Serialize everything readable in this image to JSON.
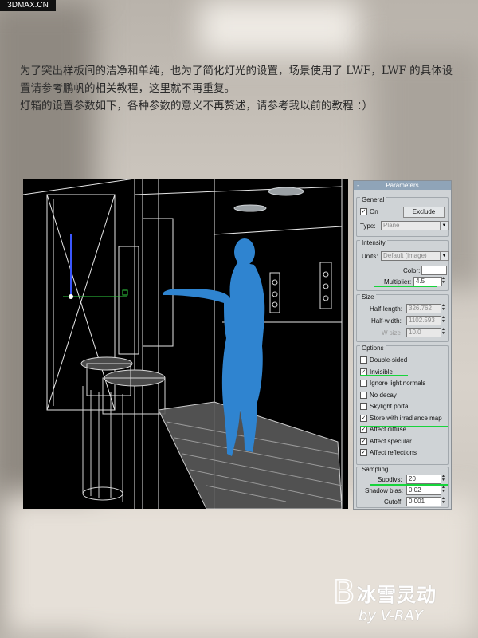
{
  "watermark_top": "3DMAX.CN",
  "intro": {
    "line1": "为了突出样板间的洁净和单纯，也为了简化灯光的设置，场景使用了 LWF，LWF 的具体设",
    "line2": "置请参考鹏帆的相关教程，这里就不再重复。",
    "line3": "灯箱的设置参数如下，各种参数的意义不再赘述，请参考我以前的教程 ：）"
  },
  "panel": {
    "title": "Parameters",
    "general": {
      "label": "General",
      "on_label": "On",
      "on_checked": true,
      "exclude_label": "Exclude",
      "type_label": "Type:",
      "type_value": "Plane"
    },
    "intensity": {
      "label": "Intensity",
      "units_label": "Units:",
      "units_value": "Default (image)",
      "color_label": "Color:",
      "color_value": "#ffffff",
      "multiplier_label": "Multiplier:",
      "multiplier_value": "4.5"
    },
    "size": {
      "label": "Size",
      "half_length_label": "Half-length:",
      "half_length_value": "326.762",
      "half_width_label": "Half-width:",
      "half_width_value": "1102.593",
      "w_size_label": "W size",
      "w_size_value": "10.0"
    },
    "options": {
      "label": "Options",
      "items": [
        {
          "label": "Double-sided",
          "checked": false
        },
        {
          "label": "Invisible",
          "checked": true
        },
        {
          "label": "Ignore light normals",
          "checked": false
        },
        {
          "label": "No decay",
          "checked": false
        },
        {
          "label": "Skylight portal",
          "checked": false
        },
        {
          "label": "Store with irradiance map",
          "checked": true
        },
        {
          "label": "Affect diffuse",
          "checked": true
        },
        {
          "label": "Affect specular",
          "checked": true
        },
        {
          "label": "Affect reflections",
          "checked": true
        }
      ]
    },
    "sampling": {
      "label": "Sampling",
      "subdivs_label": "Subdivs:",
      "subdivs_value": "20",
      "shadow_bias_label": "Shadow bias:",
      "shadow_bias_value": "0.02",
      "cutoff_label": "Cutoff:",
      "cutoff_value": "0.001"
    }
  },
  "logo": {
    "text_cn": "冰雪灵动",
    "text_by": "by V-RAY"
  },
  "colors": {
    "figure_blue": "#2f84d0",
    "highlight_green": "#17d43b",
    "panel_bg": "#cfd3d6",
    "title_bar": "#8fa4b8"
  }
}
